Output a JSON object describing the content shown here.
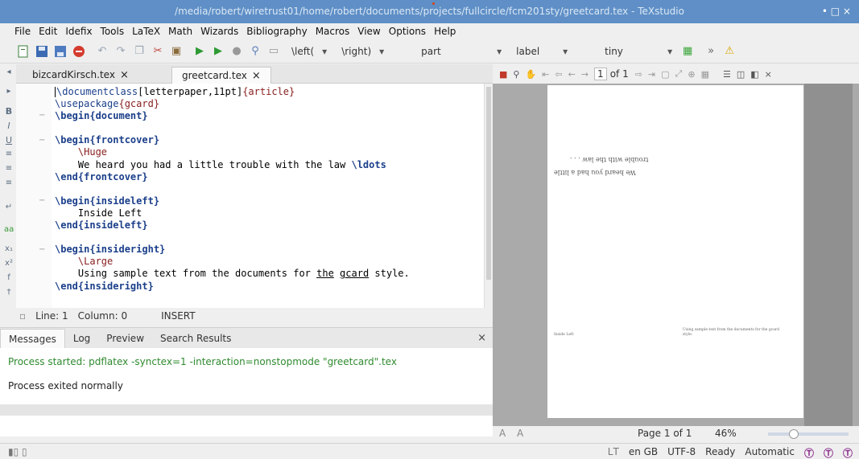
{
  "window": {
    "title": "/media/robert/wiretrust01/home/robert/documents/projects/fullcircle/fcm201sty/greetcard.tex - TeXstudio",
    "controls": "•  □  ×"
  },
  "menu": [
    "File",
    "Edit",
    "Idefix",
    "Tools",
    "LaTeX",
    "Math",
    "Wizards",
    "Bibliography",
    "Macros",
    "View",
    "Options",
    "Help"
  ],
  "toolbar": {
    "left_combo": "\\left(",
    "right_combo": "\\right)",
    "part_combo": "part",
    "label_combo": "label",
    "size_combo": "tiny",
    "more": "»",
    "warning_icon": "⚠"
  },
  "tabs": [
    {
      "label": "bizcardKirsch.tex",
      "close": "×"
    },
    {
      "label": "greetcard.tex",
      "close": "×"
    }
  ],
  "code": {
    "l1_cmd": "\\documentclass",
    "l1_opt": "[letterpaper,11pt]",
    "l1_arg": "{article}",
    "l2_cmd": "\\usepackage",
    "l2_arg": "{gcard}",
    "l3_cmd": "\\begin",
    "l3_arg": "{document}",
    "l5_cmd": "\\begin",
    "l5_arg": "{frontcover}",
    "l6_cmd": "\\Huge",
    "l7_text": "We heard you had a little trouble with the law ",
    "l7_cmd": "\\ldots",
    "l8_cmd": "\\end",
    "l8_arg": "{frontcover}",
    "l10_cmd": "\\begin",
    "l10_arg": "{insideleft}",
    "l11_text": "Inside Left",
    "l12_cmd": "\\end",
    "l12_arg": "{insideleft}",
    "l14_cmd": "\\begin",
    "l14_arg": "{insideright}",
    "l15_cmd": "\\Large",
    "l16_text_a": "Using sample text from the documents for ",
    "l16_u1": "the",
    "l16_space": " ",
    "l16_u2": "gcard",
    "l16_text_b": " style.",
    "l17_cmd": "\\end",
    "l17_arg": "{insideright}"
  },
  "status": {
    "line": "Line: 1",
    "column": "Column: 0",
    "mode": "INSERT"
  },
  "messages": {
    "tabs": [
      "Messages",
      "Log",
      "Preview",
      "Search Results"
    ],
    "close": "×",
    "started": "Process started: pdflatex -synctex=1 -interaction=nonstopmode \"greetcard\".tex",
    "exited": "Process exited normally"
  },
  "preview": {
    "page_field": "1",
    "of_pages": "of 1",
    "front_line1": "We heard you had a little",
    "front_line2": "trouble with the law . . .",
    "inside_left": "Inside Left",
    "inside_right": "Using sample text from the documents for the gcard style.",
    "page_label": "Page 1 of 1",
    "zoom": "46%",
    "zoom_fraction": 0.3
  },
  "bottombar": {
    "language": "en GB",
    "encoding": "UTF-8",
    "state": "Ready",
    "compile": "Automatic"
  },
  "colors": {
    "titlebar": "#5f8fc6",
    "message_green": "#2f8a2f",
    "keyword_blue": "#1b3f8a",
    "argument_red": "#8a2020"
  }
}
